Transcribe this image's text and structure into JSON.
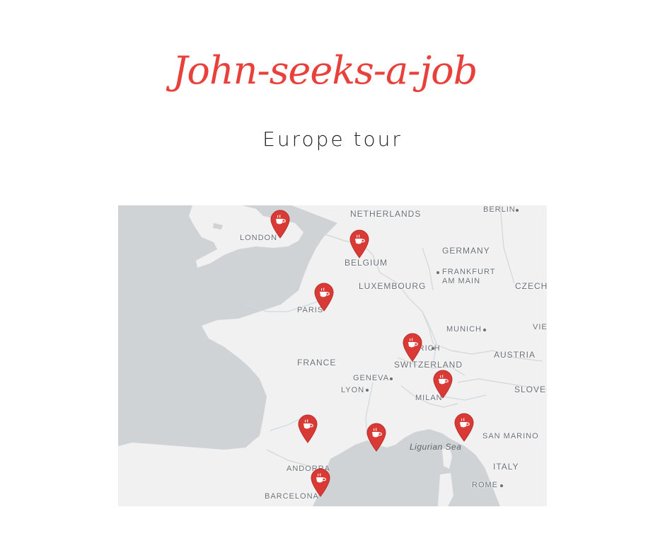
{
  "header": {
    "title": "John-seeks-a-job",
    "subtitle": "Europe tour"
  },
  "colors": {
    "brand": "#e8403b",
    "pin": "#d93a35",
    "land": "#f1f1f1",
    "sea": "#cfd3d6"
  },
  "map": {
    "countries": [
      "NETHERLANDS",
      "BELGIUM",
      "GERMANY",
      "LUXEMBOURG",
      "FRANCE",
      "SWITZERLAND",
      "AUSTRIA",
      "SLOVEN",
      "ITALY",
      "SAN MARINO",
      "ANDORRA",
      "CZECH"
    ],
    "cities": [
      "LONDON",
      "BERLIN",
      "PARIS",
      "FRANKFURT AM MAIN",
      "MUNICH",
      "VIE",
      "GENEVA",
      "LYON",
      "MILAN",
      "ZURICH",
      "BARCELONA",
      "ROME"
    ],
    "sea_label": "Ligurian Sea",
    "pin_icon": "coffee-cup-icon",
    "pins": [
      "London",
      "Brussels",
      "Paris",
      "Zurich",
      "Milan",
      "Bologna",
      "Nice",
      "Toulouse",
      "Barcelona"
    ]
  }
}
